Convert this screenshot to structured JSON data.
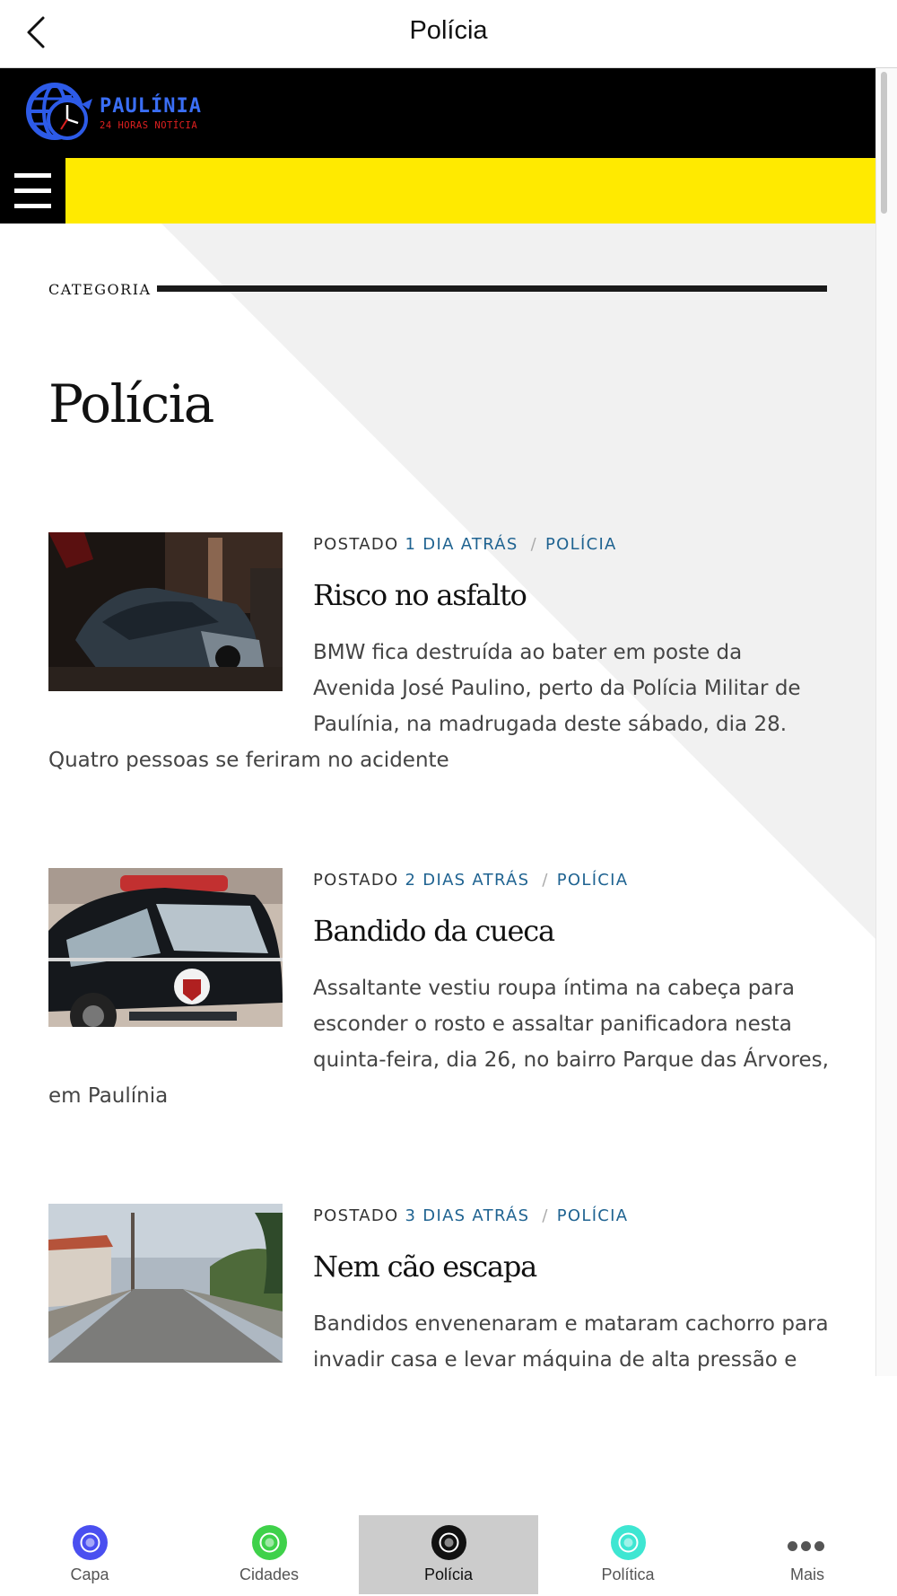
{
  "app_bar": {
    "title": "Polícia"
  },
  "site": {
    "logo_name": "PAULÍNIA",
    "logo_sub": "24 HORAS NOTÍCIA"
  },
  "category": {
    "label": "CATEGORIA",
    "title": "Polícia"
  },
  "posts": [
    {
      "prefix": "POSTADO",
      "time": "1 DIA ATRÁS",
      "sep": "/",
      "category": "POLÍCIA",
      "title": "Risco no asfalto",
      "excerpt": "BMW fica destruída ao bater em poste da Avenida José Paulino, perto da Polícia Militar de Paulínia, na madrugada deste sábado, dia 28. Quatro pessoas se feriram no acidente"
    },
    {
      "prefix": "POSTADO",
      "time": "2 DIAS ATRÁS",
      "sep": "/",
      "category": "POLÍCIA",
      "title": "Bandido da cueca",
      "excerpt": "Assaltante vestiu roupa íntima na cabeça para esconder o rosto e assaltar panificadora nesta quinta-feira, dia 26, no bairro Parque das Árvores, em Paulínia"
    },
    {
      "prefix": "POSTADO",
      "time": "3 DIAS ATRÁS",
      "sep": "/",
      "category": "POLÍCIA",
      "title": "Nem cão escapa",
      "excerpt": "Bandidos envenenaram e mataram cachorro para invadir casa e levar máquina de alta pressão e"
    }
  ],
  "tabs": [
    {
      "label": "Capa",
      "icon": "capa-logo-icon",
      "color": "#4a4ff0"
    },
    {
      "label": "Cidades",
      "icon": "cidades-logo-icon",
      "color": "#3fd14a"
    },
    {
      "label": "Polícia",
      "icon": "policia-logo-icon",
      "color": "#111111",
      "active": true
    },
    {
      "label": "Política",
      "icon": "politica-logo-icon",
      "color": "#3ee6d2"
    },
    {
      "label": "Mais",
      "icon": "more-dots-icon"
    }
  ],
  "colors": {
    "accent": "#ffea00",
    "link": "#1f6391",
    "header": "#000000"
  }
}
